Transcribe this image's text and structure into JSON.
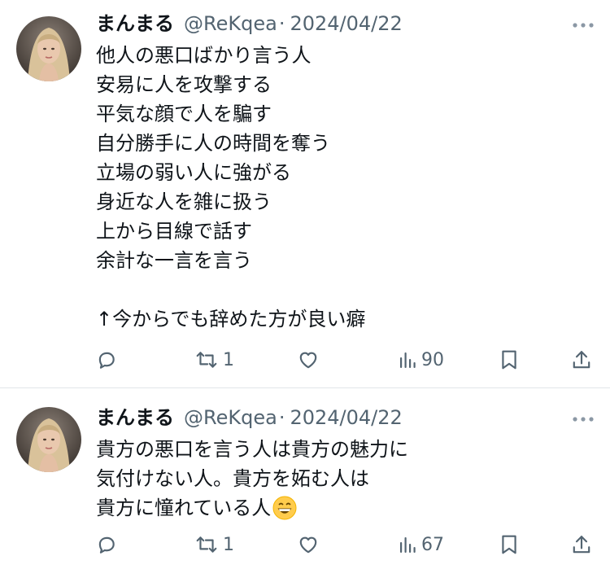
{
  "tweets": [
    {
      "name": "まんまる",
      "handle": "@ReKqea",
      "separator": "·",
      "date": "2024/04/22",
      "text": "他人の悪口ばかり言う人\n安易に人を攻撃する\n平気な顔で人を騙す\n自分勝手に人の時間を奪う\n立場の弱い人に強がる\n身近な人を雑に扱う\n上から目線で話す\n余計な一言を言う\n\n↑今からでも辞めた方が良い癖",
      "retweets": "1",
      "views": "90"
    },
    {
      "name": "まんまる",
      "handle": "@ReKqea",
      "separator": "·",
      "date": "2024/04/22",
      "text": "貴方の悪口を言う人は貴方の魅力に\n気付けない人。貴方を妬む人は\n貴方に憧れている人",
      "emoji": "grinning-face-emoji",
      "retweets": "1",
      "views": "67"
    }
  ],
  "colors": {
    "text": "#0f1419",
    "secondary": "#536471",
    "divider": "#e1e5e8"
  },
  "icons": [
    "more-icon",
    "reply-icon",
    "retweet-icon",
    "like-icon",
    "views-icon",
    "bookmark-icon",
    "share-icon"
  ]
}
